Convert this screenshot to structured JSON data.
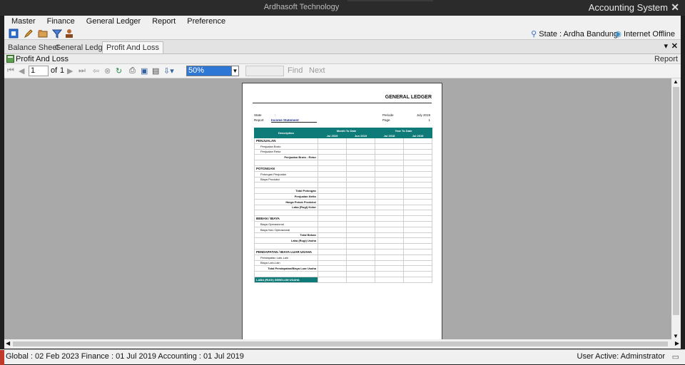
{
  "titlebar": {
    "app_title": "Ardhasoft Technology",
    "system_title": "Accounting System",
    "close_label": "✕"
  },
  "menu": {
    "items": [
      "Master",
      "Finance",
      "General Ledger",
      "Report",
      "Preference"
    ]
  },
  "toolbar": {
    "state": "State : Ardha Bandung",
    "connection": "Internet Offline"
  },
  "tabs": {
    "items": [
      "Balance Sheet",
      "General Ledger",
      "Profit And Loss"
    ],
    "active": "Profit And Loss"
  },
  "document": {
    "title": "Profit And Loss",
    "right_label": "Report"
  },
  "report_toolbar": {
    "page": "1",
    "of_label": "of",
    "total_pages": "1",
    "zoom": "50%",
    "find_label": "Find",
    "next_label": "Next"
  },
  "report": {
    "title": "GENERAL LEDGER",
    "state_label": "State",
    "state_value": ":",
    "report_label": "Report",
    "report_value": "Income Statement",
    "period_label": "Periode",
    "period_value": "July 2019",
    "page_label": "Page",
    "page_value": "1",
    "header_row1": [
      "Description",
      "Month To Date",
      "Year To Date"
    ],
    "header_row2": [
      "Jul 2019",
      "Jun 2019",
      "Jul 2018",
      "Jul 2019"
    ],
    "rows": [
      {
        "type": "sec",
        "label": "PENJUALAN"
      },
      {
        "type": "sub",
        "label": "Penjualan Bruto"
      },
      {
        "type": "sub",
        "label": "Penjualan Retur"
      },
      {
        "type": "tot",
        "label": "Penjualan Bruto - Retur"
      },
      {
        "type": "blank",
        "label": ""
      },
      {
        "type": "sec",
        "label": "POTONGAN"
      },
      {
        "type": "sub",
        "label": "Potongan Penjualan"
      },
      {
        "type": "sub",
        "label": "Biaya Produksi"
      },
      {
        "type": "blank",
        "label": ""
      },
      {
        "type": "tot",
        "label": "Total Potongan"
      },
      {
        "type": "tot",
        "label": "Penjualan Netto"
      },
      {
        "type": "tot",
        "label": "Harga Pokok Produksi"
      },
      {
        "type": "tot",
        "label": "Laba (Rugi) Kotor"
      },
      {
        "type": "blank",
        "label": ""
      },
      {
        "type": "sec",
        "label": "BEBAN / BIAYA"
      },
      {
        "type": "sub",
        "label": "Biaya Operasional"
      },
      {
        "type": "sub",
        "label": "Biaya Non Operasional"
      },
      {
        "type": "tot",
        "label": "Total Beban"
      },
      {
        "type": "tot",
        "label": "Laba (Rugi) Usaha"
      },
      {
        "type": "blank",
        "label": ""
      },
      {
        "type": "sec",
        "label": "PENDAPATAN / BIAYA LUAR USAHA"
      },
      {
        "type": "sub",
        "label": "Pendapatan Lain-Lain"
      },
      {
        "type": "sub",
        "label": "Biaya Lain-Lain"
      },
      {
        "type": "tot",
        "label": "Total Pendapatan/Biaya Luar Usaha"
      },
      {
        "type": "blank",
        "label": ""
      },
      {
        "type": "hl",
        "label": "LABA (RUGI) SEBELUM USAHA"
      }
    ]
  },
  "status": {
    "left": "Global : 02 Feb 2023   Finance : 01 Jul 2019   Accounting : 01 Jul 2019",
    "right": "User Active: Adminstrator"
  }
}
